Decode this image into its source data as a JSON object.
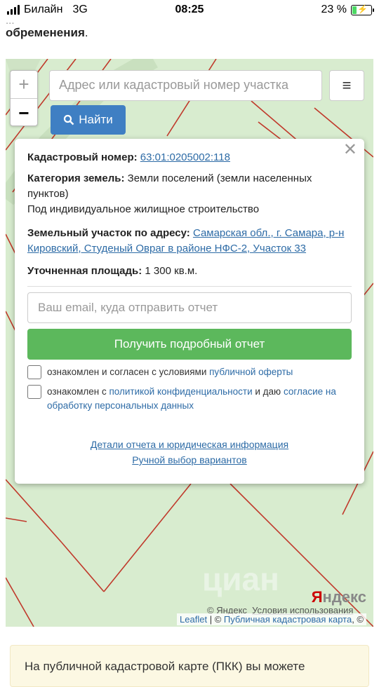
{
  "status": {
    "carrier": "Билайн",
    "network": "3G",
    "time": "08:25",
    "battery_percent": "23 %",
    "battery_level": 0.23
  },
  "top": {
    "faded_line": "...",
    "bold_text": "обременения",
    "tail": "."
  },
  "map": {
    "search_placeholder": "Адрес или кадастровый номер участка",
    "zoom_in": "+",
    "zoom_out": "−",
    "menu_icon": "≡",
    "find_label": "Найти",
    "attribution": {
      "leaflet": "Leaflet",
      "sep": " | © ",
      "pkk": "Публичная кадастровая карта",
      "tail": ", ©"
    },
    "yandex_copy": "© Яндекс",
    "yandex_terms": "Условия использования",
    "yandex_logo": "Яндекс",
    "watermark": "циан"
  },
  "popup": {
    "cadastre_label": "Кадастровый номер:",
    "cadastre_value": "63:01:0205002:118",
    "category_label": "Категория земель:",
    "category_value": "Земли поселений (земли населенных пунктов)",
    "usage": "Под индивидуальное жилищное строительство",
    "address_label": "Земельный участок по адресу:",
    "address_value": "Самарская обл., г. Самара, р-н Кировский, Студеный Овраг в районе НФС-2, Участок 33",
    "area_label": "Уточненная площадь:",
    "area_value": "1 300 кв.м.",
    "email_placeholder": "Ваш email, куда отправить отчет",
    "get_report": "Получить подробный отчет",
    "consent1_text": "ознакомлен и согласен с условиями ",
    "consent1_link": "публичной оферты",
    "consent2_text": "ознакомлен с ",
    "consent2_link1": "политикой конфиденциальности",
    "consent2_mid": " и даю ",
    "consent2_link2": "согласие на обработку персональных данных",
    "details_link": "Детали отчета и юридическая информация",
    "manual_link": "Ручной выбор вариантов",
    "close": "✕"
  },
  "info": {
    "text": "На публичной кадастровой карте (ПКК) вы можете"
  },
  "colors": {
    "map_bg": "#d8eccf",
    "parcel_line": "#c0392b",
    "find_btn": "#3f7fc3",
    "report_btn": "#5cb85c",
    "link": "#2d6ba6"
  }
}
